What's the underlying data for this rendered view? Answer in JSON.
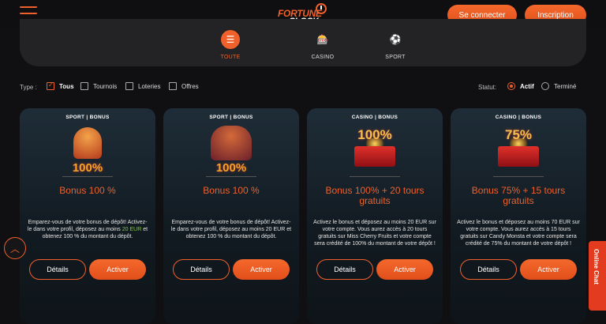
{
  "header": {
    "logo_top": "FORTUNE",
    "logo_bottom": "CLOCK",
    "login_label": "Se connecter",
    "signup_label": "Inscription"
  },
  "categories": [
    {
      "label": "TOUTE",
      "icon": "grid-icon",
      "active": true
    },
    {
      "label": "CASINO",
      "icon": "slot-machine-icon",
      "active": false
    },
    {
      "label": "SPORT",
      "icon": "soccer-ball-icon",
      "active": false
    }
  ],
  "filters": {
    "type_label": "Type :",
    "types": [
      {
        "label": "Tous",
        "checked": true
      },
      {
        "label": "Tournois",
        "checked": false
      },
      {
        "label": "Loteries",
        "checked": false
      },
      {
        "label": "Offres",
        "checked": false
      }
    ],
    "status_label": "Statut:",
    "statuses": [
      {
        "label": "Actif",
        "selected": true
      },
      {
        "label": "Terminé",
        "selected": false
      }
    ]
  },
  "cards": [
    {
      "tag": "SPORT | BONUS",
      "badge": "100%",
      "title": "Bonus 100 %",
      "desc_pre": "Emparez-vous de votre bonus de dépôt! Activez-le dans votre profil, déposez au moins ",
      "desc_highlight": "20 EUR",
      "desc_post": " et obtenez 100 % du montant du dépôt.",
      "details_label": "Détails",
      "activate_label": "Activer"
    },
    {
      "tag": "SPORT | BONUS",
      "badge": "100%",
      "title": "Bonus 100 %",
      "desc": "Emparez-vous de votre bonus de dépôt! Activez-le dans votre profil, déposez au moins 20 EUR et obtenez 100 % du montant du dépôt.",
      "details_label": "Détails",
      "activate_label": "Activer"
    },
    {
      "tag": "CASINO | BONUS",
      "badge": "100%",
      "title": "Bonus 100% + 20 tours gratuits",
      "desc": "Activez le bonus et déposez au moins 20 EUR sur votre compte. Vous aurez accès à 20 tours gratuits sur Miss Cherry Fruits et votre compte sera crédité de 100% du montant de votre dépôt !",
      "details_label": "Détails",
      "activate_label": "Activer"
    },
    {
      "tag": "CASINO | BONUS",
      "badge": "75%",
      "title": "Bonus 75% + 15 tours gratuits",
      "desc": "Activez le bonus et déposez au moins 70 EUR sur votre compte. Vous aurez accès à 15 tours gratuits sur Candy Monsta et votre compte sera crédité de 75% du montant de votre dépôt !",
      "details_label": "Détails",
      "activate_label": "Activer"
    }
  ],
  "chat_label": "Online Chat",
  "colors": {
    "accent": "#f0602a",
    "highlight": "#7ed321"
  }
}
